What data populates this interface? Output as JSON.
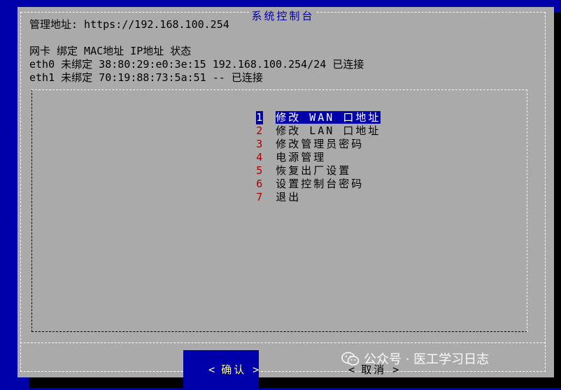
{
  "dialog": {
    "title": "系统控制台"
  },
  "info": {
    "address_line": "管理地址: https://192.168.100.254",
    "header_line": "网卡 绑定 MAC地址 IP地址 状态",
    "eth0_line": "eth0 未绑定 38:80:29:e0:3e:15 192.168.100.254/24 已连接",
    "eth1_line": "eth1 未绑定 70:19:88:73:5a:51 -- 已连接"
  },
  "menu": {
    "items": [
      {
        "num": "1",
        "label": "修改 WAN 口地址",
        "selected": true
      },
      {
        "num": "2",
        "label": "修改 LAN 口地址"
      },
      {
        "num": "3",
        "label": "修改管理员密码"
      },
      {
        "num": "4",
        "label": "电源管理"
      },
      {
        "num": "5",
        "label": "恢复出厂设置"
      },
      {
        "num": "6",
        "label": "设置控制台密码"
      },
      {
        "num": "7",
        "label": "退出"
      }
    ]
  },
  "buttons": {
    "ok_left": "<",
    "ok_label": "确认",
    "ok_right": ">",
    "cancel_left": "<",
    "cancel_label": "取消",
    "cancel_right": ">"
  },
  "watermark": {
    "text": "公众号 · 医工学习日志",
    "icon": "wechat-icon"
  },
  "colors": {
    "background": "#0000aa",
    "dialog": "#aaaaaa",
    "highlight": "#0000aa",
    "hotkey": "#aa0000",
    "button_hotkey": "#ffff55"
  }
}
